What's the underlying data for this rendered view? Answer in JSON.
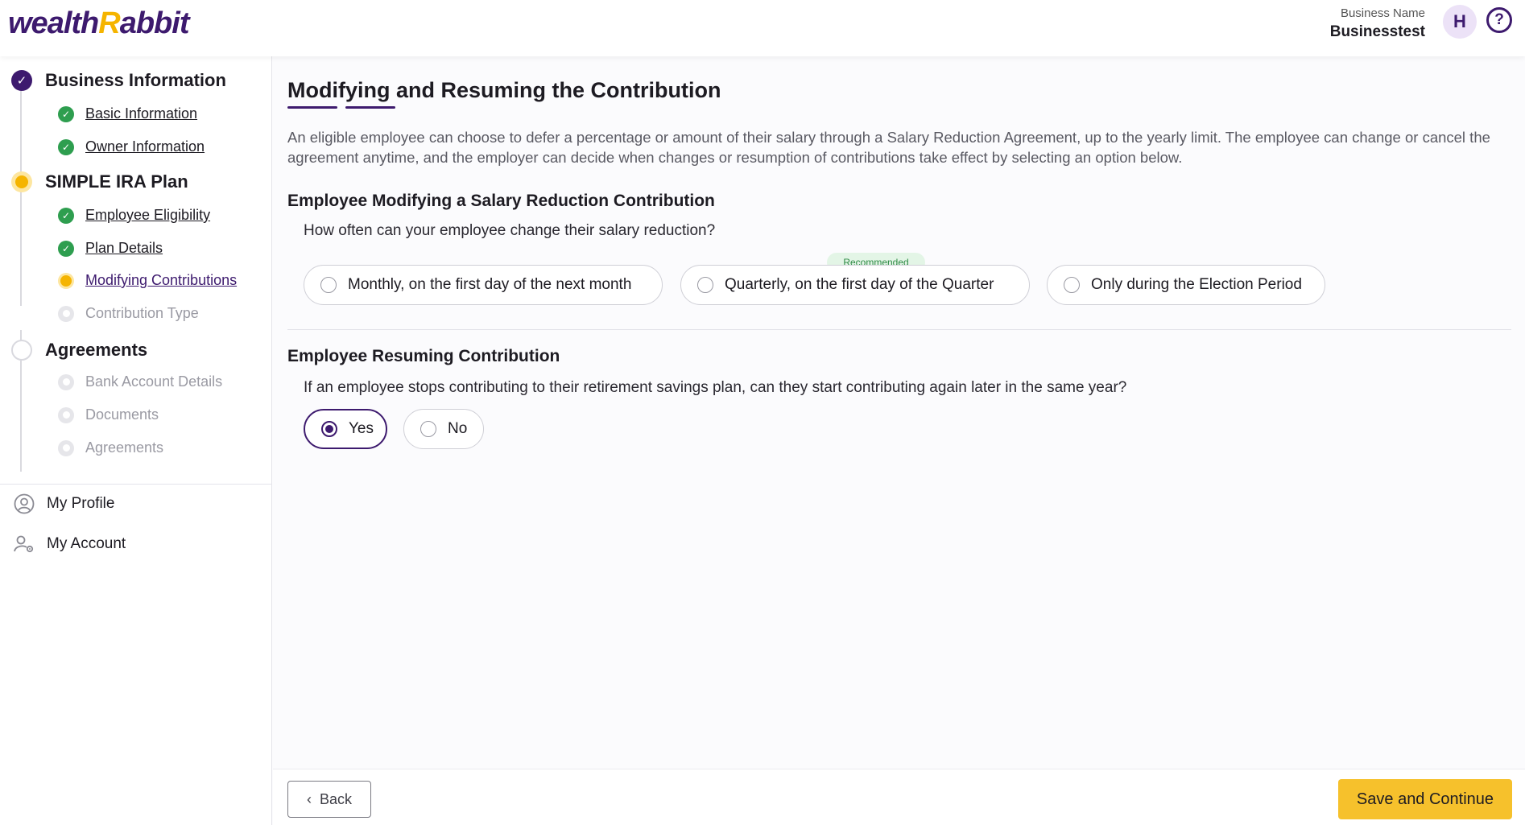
{
  "header": {
    "logo_main": "wealth",
    "logo_r": "R",
    "logo_rest": "abbit",
    "business_label": "Business Name",
    "business_name": "Businesstest",
    "avatar_initial": "H",
    "help_glyph": "?"
  },
  "sidebar": {
    "sections": [
      {
        "title": "Business Information",
        "status": "done"
      },
      {
        "title": "SIMPLE IRA Plan",
        "status": "current"
      },
      {
        "title": "Agreements",
        "status": "pending"
      }
    ],
    "items": [
      {
        "label": "Basic Information",
        "status": "done"
      },
      {
        "label": "Owner Information",
        "status": "done"
      },
      {
        "label": "Employee Eligibility",
        "status": "done"
      },
      {
        "label": "Plan Details",
        "status": "done"
      },
      {
        "label": "Modifying Contributions",
        "status": "current"
      },
      {
        "label": "Contribution Type",
        "status": "pending"
      },
      {
        "label": "Bank Account Details",
        "status": "pending"
      },
      {
        "label": "Documents",
        "status": "pending"
      },
      {
        "label": "Agreements",
        "status": "pending"
      }
    ],
    "nav": {
      "profile": "My Profile",
      "account": "My Account"
    }
  },
  "main": {
    "title": "Modifying and Resuming the Contribution",
    "description": "An eligible employee can choose to defer a percentage or amount of their salary through a Salary Reduction Agreement, up to the yearly limit. The employee can change or cancel the agreement anytime, and the employer can decide when changes or resumption of contributions take effect by selecting an option below.",
    "q1": {
      "title": "Employee Modifying a Salary Reduction Contribution",
      "question": "How often can your employee change their salary reduction?",
      "badge": "Recommended",
      "options": [
        {
          "label": "Monthly, on the first day of the next month",
          "selected": false
        },
        {
          "label": "Quarterly, on the first day of the Quarter",
          "selected": false
        },
        {
          "label": "Only during the Election Period",
          "selected": false
        }
      ]
    },
    "q2": {
      "title": "Employee Resuming Contribution",
      "question": "If an employee stops contributing to their retirement savings plan, can they start contributing again later in the same year?",
      "options": [
        {
          "label": "Yes",
          "selected": true
        },
        {
          "label": "No",
          "selected": false
        }
      ]
    }
  },
  "footer": {
    "back": "Back",
    "save": "Save and Continue"
  },
  "colors": {
    "brand_purple": "#3d1a6e",
    "brand_yellow": "#f5b400",
    "done_green": "#2e9e4f",
    "save_button": "#f6c12c"
  }
}
